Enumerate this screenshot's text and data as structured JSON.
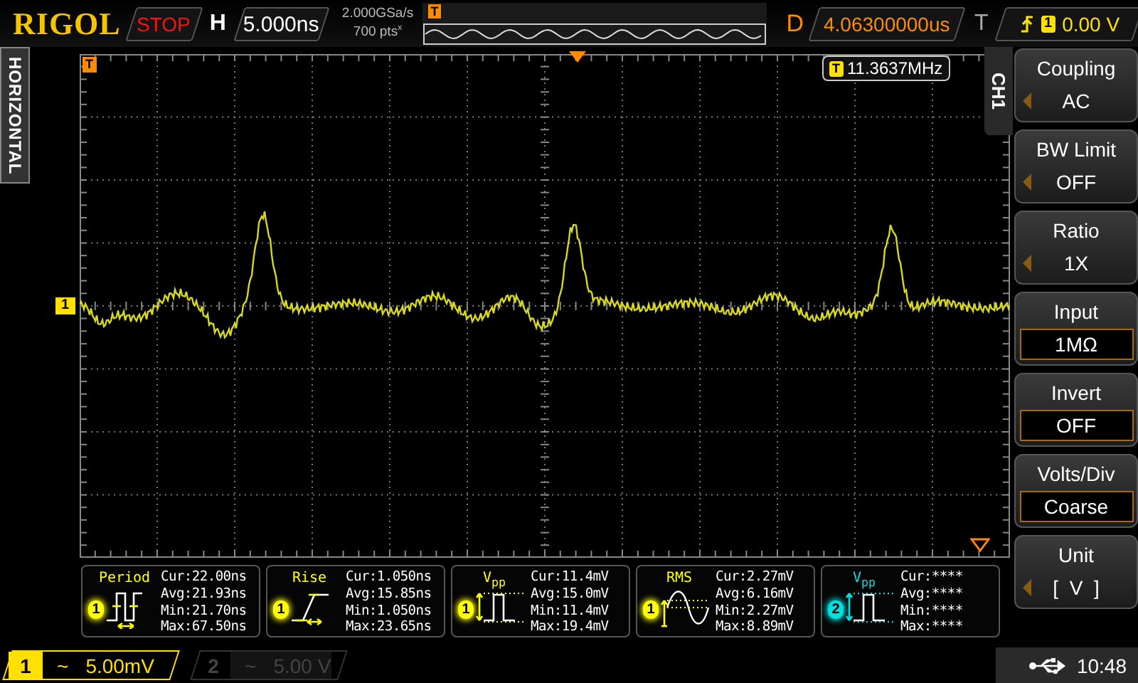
{
  "brand": "RIGOL",
  "run_state": "STOP",
  "horizontal": {
    "label": "H",
    "timebase": "5.000ns",
    "sample_rate": "2.000GSa/s",
    "memory_depth": "700 pts$^{x}$"
  },
  "overview_trigger": "T",
  "delay": {
    "label": "D",
    "value": "4.06300000us"
  },
  "trigger": {
    "label": "T",
    "channel": "1",
    "voltage": "0.00 V"
  },
  "side_tab": "HORIZONTAL",
  "menu_title": "CH1",
  "screen": {
    "trigger_flag": "T",
    "channel_marker": "1",
    "frequency": {
      "icon": "T",
      "value": "11.3637MHz"
    }
  },
  "menu": [
    {
      "label": "Coupling",
      "value": "AC",
      "kind": "select"
    },
    {
      "label": "BW Limit",
      "value": "OFF",
      "kind": "select"
    },
    {
      "label": "Ratio",
      "value": "1X",
      "kind": "select"
    },
    {
      "label": "Input",
      "value": "1MΩ",
      "kind": "box"
    },
    {
      "label": "Invert",
      "value": "OFF",
      "kind": "box"
    },
    {
      "label": "Volts/Div",
      "value": "Coarse",
      "kind": "box"
    },
    {
      "label": "Unit",
      "value": "[  V  ]",
      "kind": "select"
    }
  ],
  "measurements": [
    {
      "title": "Period",
      "kind": "period",
      "channel": "1",
      "color": "#ffff00",
      "lines": [
        "Cur:22.00ns",
        "Avg:21.93ns",
        "Min:21.70ns",
        "Max:67.50ns"
      ]
    },
    {
      "title": "Rise",
      "kind": "rise",
      "channel": "1",
      "color": "#ffff00",
      "lines": [
        "Cur:1.050ns",
        "Avg:15.85ns",
        "Min:1.050ns",
        "Max:23.65ns"
      ]
    },
    {
      "title": "V$_{pp}$",
      "kind": "vpp",
      "channel": "1",
      "color": "#ffff00",
      "lines": [
        "Cur:11.4mV",
        "Avg:15.0mV",
        "Min:11.4mV",
        "Max:19.4mV"
      ]
    },
    {
      "title": "RMS",
      "kind": "rms",
      "channel": "1",
      "color": "#ffff00",
      "lines": [
        "Cur:2.27mV",
        "Avg:6.16mV",
        "Min:2.27mV",
        "Max:8.89mV"
      ]
    },
    {
      "title": "V$_{pp}$",
      "kind": "vpp",
      "channel": "2",
      "color": "#00e0e0",
      "lines": [
        "Cur:****",
        "Avg:****",
        "Min:****",
        "Max:****"
      ]
    }
  ],
  "channels": [
    {
      "number": "1",
      "coupling": "~",
      "scale": "5.00mV",
      "on": true
    },
    {
      "number": "2",
      "coupling": "~",
      "scale": "5.00 V",
      "on": false
    }
  ],
  "status": {
    "time": "10:48"
  }
}
